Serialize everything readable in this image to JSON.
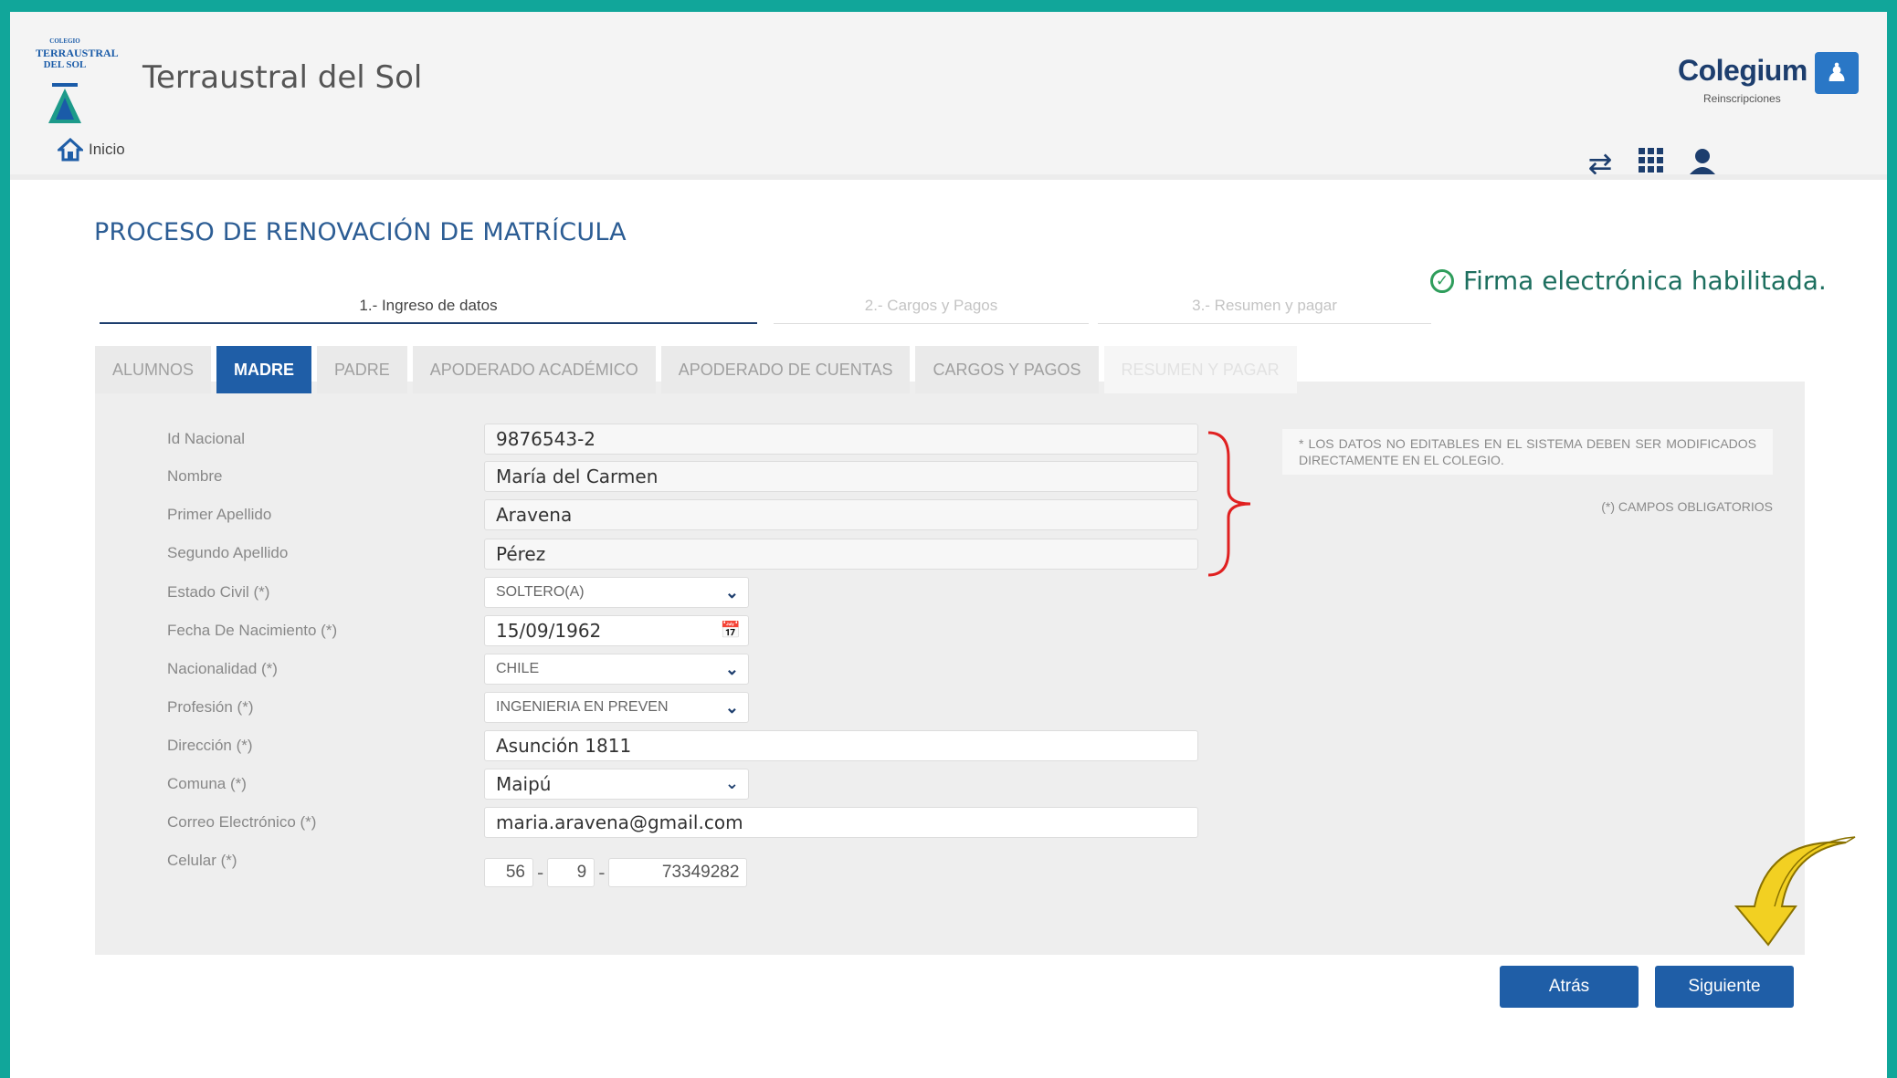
{
  "header": {
    "logo": {
      "top": "COLEGIO",
      "line1": "TERRAUSTRAL",
      "line2": "DEL SOL"
    },
    "school_name": "Terraustral del Sol",
    "brand_name": "Colegium",
    "brand_sub": "Reinscripciones",
    "home_label": "Inicio",
    "nav_icons": [
      "switch-icon",
      "apps-grid-icon",
      "user-icon"
    ]
  },
  "page": {
    "title": "PROCESO DE RENOVACIÓN DE MATRÍCULA",
    "firma": "Firma electrónica habilitada."
  },
  "steps": [
    "1.- Ingreso de datos",
    "2.- Cargos y Pagos",
    "3.- Resumen y pagar"
  ],
  "tabs": [
    {
      "label": "ALUMNOS",
      "state": "normal"
    },
    {
      "label": "MADRE",
      "state": "active"
    },
    {
      "label": "PADRE",
      "state": "normal"
    },
    {
      "label": "APODERADO ACADÉMICO",
      "state": "normal"
    },
    {
      "label": "APODERADO DE CUENTAS",
      "state": "normal"
    },
    {
      "label": "CARGOS Y PAGOS",
      "state": "normal"
    },
    {
      "label": "RESUMEN Y PAGAR",
      "state": "disabled"
    }
  ],
  "form": {
    "id_nacional": {
      "label": "Id Nacional",
      "value": "9876543-2"
    },
    "nombre": {
      "label": "Nombre",
      "value": "María del Carmen"
    },
    "primer_apellido": {
      "label": "Primer Apellido",
      "value": "Aravena"
    },
    "segundo_apellido": {
      "label": "Segundo Apellido",
      "value": "Pérez"
    },
    "estado_civil": {
      "label": "Estado Civil (*)",
      "value": "SOLTERO(A)"
    },
    "fecha_nacimiento": {
      "label": "Fecha De Nacimiento (*)",
      "value": "15/09/1962"
    },
    "nacionalidad": {
      "label": "Nacionalidad (*)",
      "value": "CHILE"
    },
    "profesion": {
      "label": "Profesión (*)",
      "value": "INGENIERIA EN PREVEN"
    },
    "direccion": {
      "label": "Dirección (*)",
      "value": "Asunción 1811"
    },
    "comuna": {
      "label": "Comuna (*)",
      "value": "Maipú"
    },
    "correo": {
      "label": "Correo Electrónico (*)",
      "value": "maria.aravena@gmail.com"
    },
    "celular": {
      "label": "Celular (*)",
      "country": "56",
      "area": "9",
      "number": "73349282",
      "separator": "-"
    }
  },
  "notes": {
    "no_editables": "* LOS DATOS NO EDITABLES EN EL SISTEMA DEBEN SER MODIFICADOS DIRECTAMENTE EN EL COLEGIO.",
    "obligatorios": "(*) CAMPOS OBLIGATORIOS"
  },
  "buttons": {
    "atras": "Atrás",
    "siguiente": "Siguiente"
  },
  "colors": {
    "accent": "#1f5ea7",
    "frame": "#11a69a",
    "annotation": "#e02020",
    "arrow": "#f2d022"
  }
}
